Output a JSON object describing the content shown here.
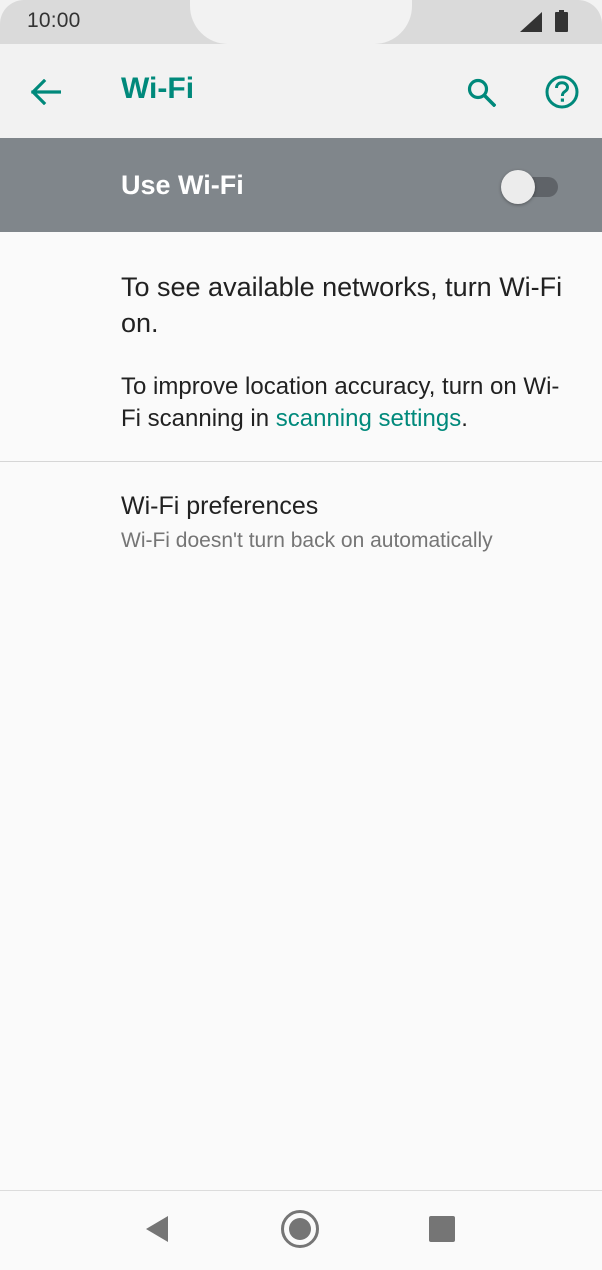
{
  "status_bar": {
    "time": "10:00",
    "icons": [
      "signal-icon",
      "battery-icon"
    ]
  },
  "app_bar": {
    "title": "Wi-Fi",
    "back_icon": "arrow-back-icon",
    "search_icon": "search-icon",
    "help_icon": "help-icon"
  },
  "master_switch": {
    "label": "Use Wi-Fi",
    "state": "off"
  },
  "info": {
    "main": "To see available networks, turn Wi-Fi on.",
    "secondary_prefix": "To improve location accuracy, turn on Wi-Fi scanning in ",
    "secondary_link": "scanning settings",
    "secondary_suffix": "."
  },
  "preferences": {
    "title": "Wi-Fi preferences",
    "summary": "Wi-Fi doesn't turn back on automatically"
  },
  "nav_bar": {
    "icons": [
      "nav-back-icon",
      "nav-home-icon",
      "nav-recents-icon"
    ]
  },
  "colors": {
    "accent": "#00897b",
    "switch_bar": "#80868b",
    "background": "#fafafa"
  }
}
